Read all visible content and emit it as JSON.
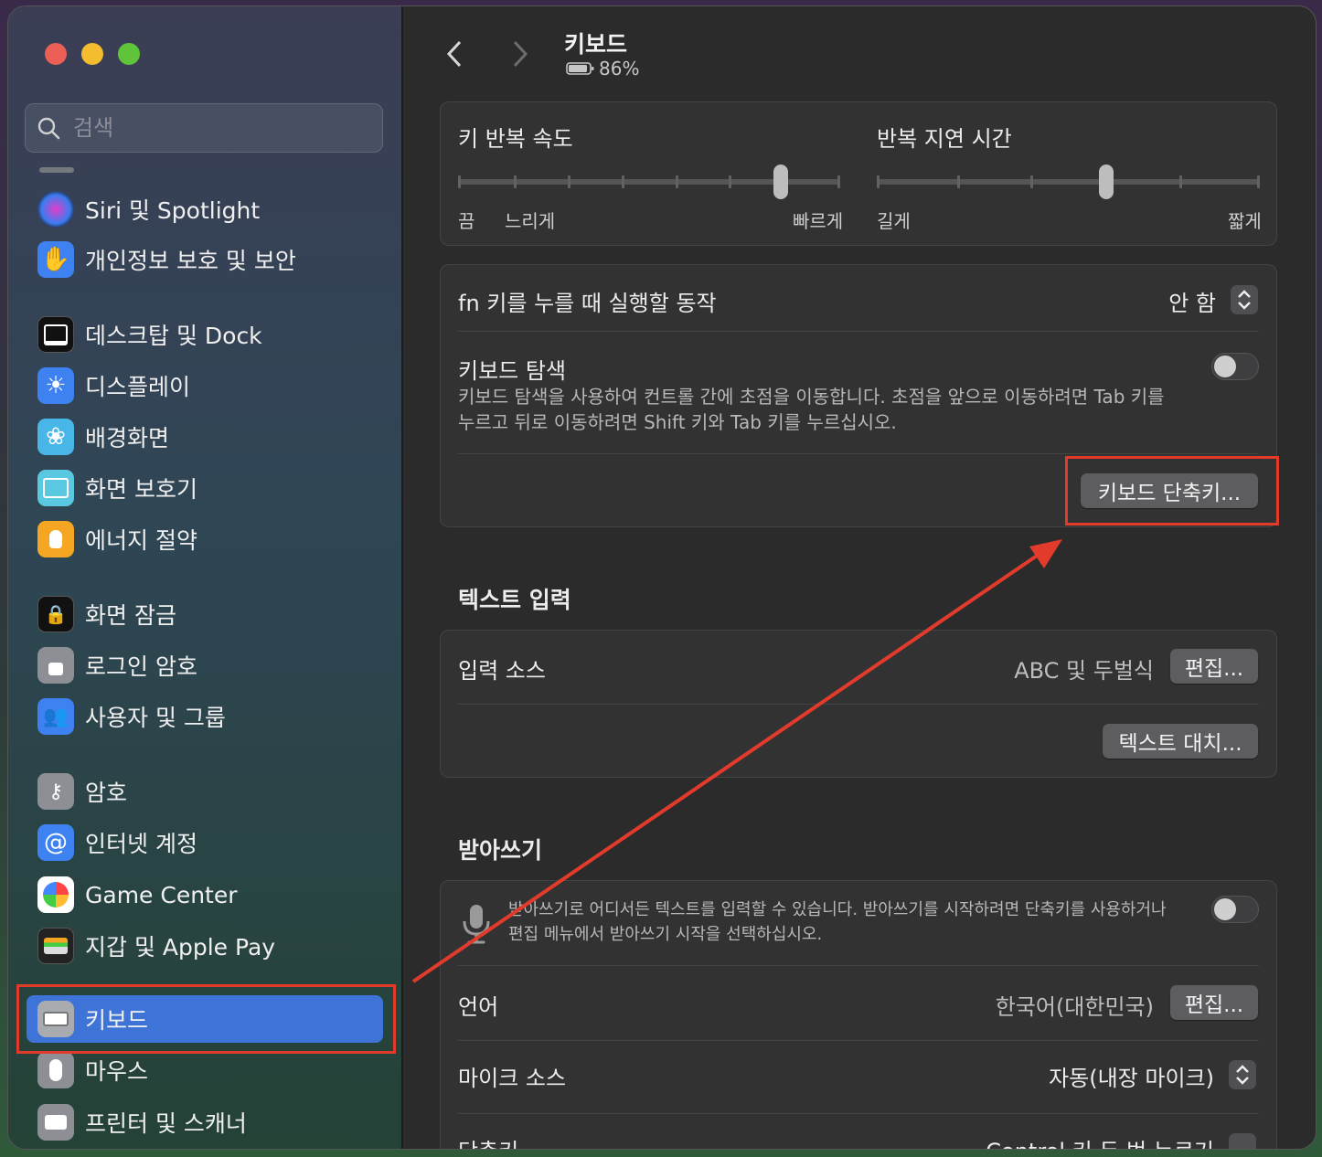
{
  "window": {
    "title": "키보드",
    "battery": "86%"
  },
  "sidebar": {
    "search_placeholder": "검색",
    "items": [
      {
        "label": "Siri 및 Spotlight",
        "icon": "siri-icon"
      },
      {
        "label": "개인정보 보호 및 보안",
        "icon": "hand-icon"
      },
      {
        "label": "데스크탑 및 Dock",
        "icon": "dock-icon"
      },
      {
        "label": "디스플레이",
        "icon": "sun-icon"
      },
      {
        "label": "배경화면",
        "icon": "flower-icon"
      },
      {
        "label": "화면 보호기",
        "icon": "screensaver-icon"
      },
      {
        "label": "에너지 절약",
        "icon": "bulb-icon"
      },
      {
        "label": "화면 잠금",
        "icon": "lock-screen-icon"
      },
      {
        "label": "로그인 암호",
        "icon": "lock-icon"
      },
      {
        "label": "사용자 및 그룹",
        "icon": "users-icon"
      },
      {
        "label": "암호",
        "icon": "key-icon"
      },
      {
        "label": "인터넷 계정",
        "icon": "at-icon"
      },
      {
        "label": "Game Center",
        "icon": "game-center-icon"
      },
      {
        "label": "지갑 및 Apple Pay",
        "icon": "wallet-icon"
      },
      {
        "label": "키보드",
        "icon": "keyboard-icon",
        "active": true
      },
      {
        "label": "마우스",
        "icon": "mouse-icon"
      },
      {
        "label": "프린터 및 스캐너",
        "icon": "printer-icon"
      }
    ]
  },
  "keyboard": {
    "repeat_rate": {
      "label": "키 반복 속도",
      "min_label": "끔",
      "slow_label": "느리게",
      "max_label": "빠르게"
    },
    "repeat_delay": {
      "label": "반복 지연 시간",
      "min_label": "길게",
      "max_label": "짧게"
    },
    "fn_key": {
      "label": "fn 키를 누를 때 실행할 동작",
      "value": "안 함"
    },
    "keyboard_nav": {
      "label": "키보드 탐색",
      "desc_line1": "키보드 탐색을 사용하여 컨트롤 간에 초점을 이동합니다. 초점을 앞으로 이동하려면 Tab 키를",
      "desc_line2": "누르고 뒤로 이동하려면 Shift 키와 Tab 키를 누르십시오."
    },
    "shortcuts_button": "키보드 단축키..."
  },
  "text_input": {
    "section": "텍스트 입력",
    "input_sources_label": "입력 소스",
    "input_sources_value": "ABC 및 두벌식",
    "edit_button": "편집...",
    "text_replace_button": "텍스트 대치..."
  },
  "dictation": {
    "section": "받아쓰기",
    "desc_line1": "받아쓰기로 어디서든 텍스트를 입력할 수 있습니다. 받아쓰기를 시작하려면 단축키를 사용하거나",
    "desc_line2": "편집 메뉴에서 받아쓰기 시작을 선택하십시오.",
    "language_label": "언어",
    "language_value": "한국어(대한민국)",
    "edit_button": "편집...",
    "mic_label": "마이크 소스",
    "mic_value": "자동(내장 마이크)",
    "shortcut_label": "단축키",
    "shortcut_value": "Control 키 두 번 누르기"
  },
  "colors": {
    "accent": "#3e73d8",
    "highlight": "#e23b2c"
  }
}
